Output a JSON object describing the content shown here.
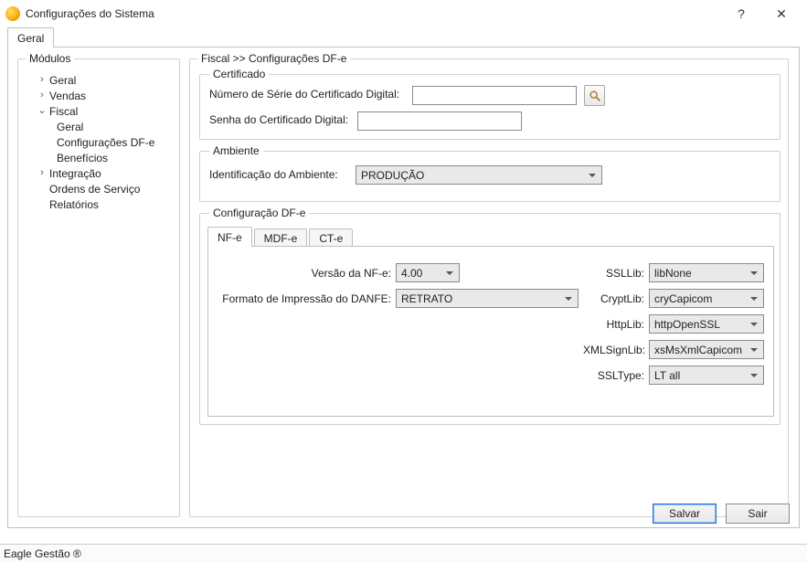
{
  "window": {
    "title": "Configurações do Sistema"
  },
  "outer_tab": {
    "geral": "Geral"
  },
  "modules": {
    "legend": "Módulos",
    "items": [
      {
        "label": "Geral",
        "expander": ">",
        "level": 1
      },
      {
        "label": "Vendas",
        "expander": ">",
        "level": 1
      },
      {
        "label": "Fiscal",
        "expander": "v",
        "level": 1
      },
      {
        "label": "Geral",
        "level": 2
      },
      {
        "label": "Configurações DF-e",
        "level": 2
      },
      {
        "label": "Benefícios",
        "level": 2
      },
      {
        "label": "Integração",
        "expander": ">",
        "level": 1
      },
      {
        "label": "Ordens de Serviço",
        "level": 1,
        "noexp": true
      },
      {
        "label": "Relatórios",
        "level": 1,
        "noexp": true
      }
    ]
  },
  "breadcrumb": "Fiscal >> Configurações DF-e",
  "certificado": {
    "legend": "Certificado",
    "serie_label": "Número de Série do Certificado Digital:",
    "serie_value": "",
    "senha_label": "Senha do Certificado Digital:",
    "senha_value": ""
  },
  "ambiente": {
    "legend": "Ambiente",
    "label": "Identificação do Ambiente:",
    "value": "PRODUÇÃO"
  },
  "dfe": {
    "legend": "Configuração DF-e",
    "tabs": {
      "nfe": "NF-e",
      "mdfe": "MDF-e",
      "cte": "CT-e"
    },
    "versao_label": "Versão da NF-e:",
    "versao_value": "4.00",
    "danfe_label": "Formato de Impressão do DANFE:",
    "danfe_value": "RETRATO",
    "ssllib_label": "SSLLib:",
    "ssllib_value": "libNone",
    "cryptlib_label": "CryptLib:",
    "cryptlib_value": "cryCapicom",
    "httplib_label": "HttpLib:",
    "httplib_value": "httpOpenSSL",
    "xmlsignlib_label": "XMLSignLib:",
    "xmlsignlib_value": "xsMsXmlCapicom",
    "ssltype_label": "SSLType:",
    "ssltype_value": "LT all"
  },
  "buttons": {
    "save": "Salvar",
    "exit": "Sair"
  },
  "status": "Eagle Gestão ®"
}
